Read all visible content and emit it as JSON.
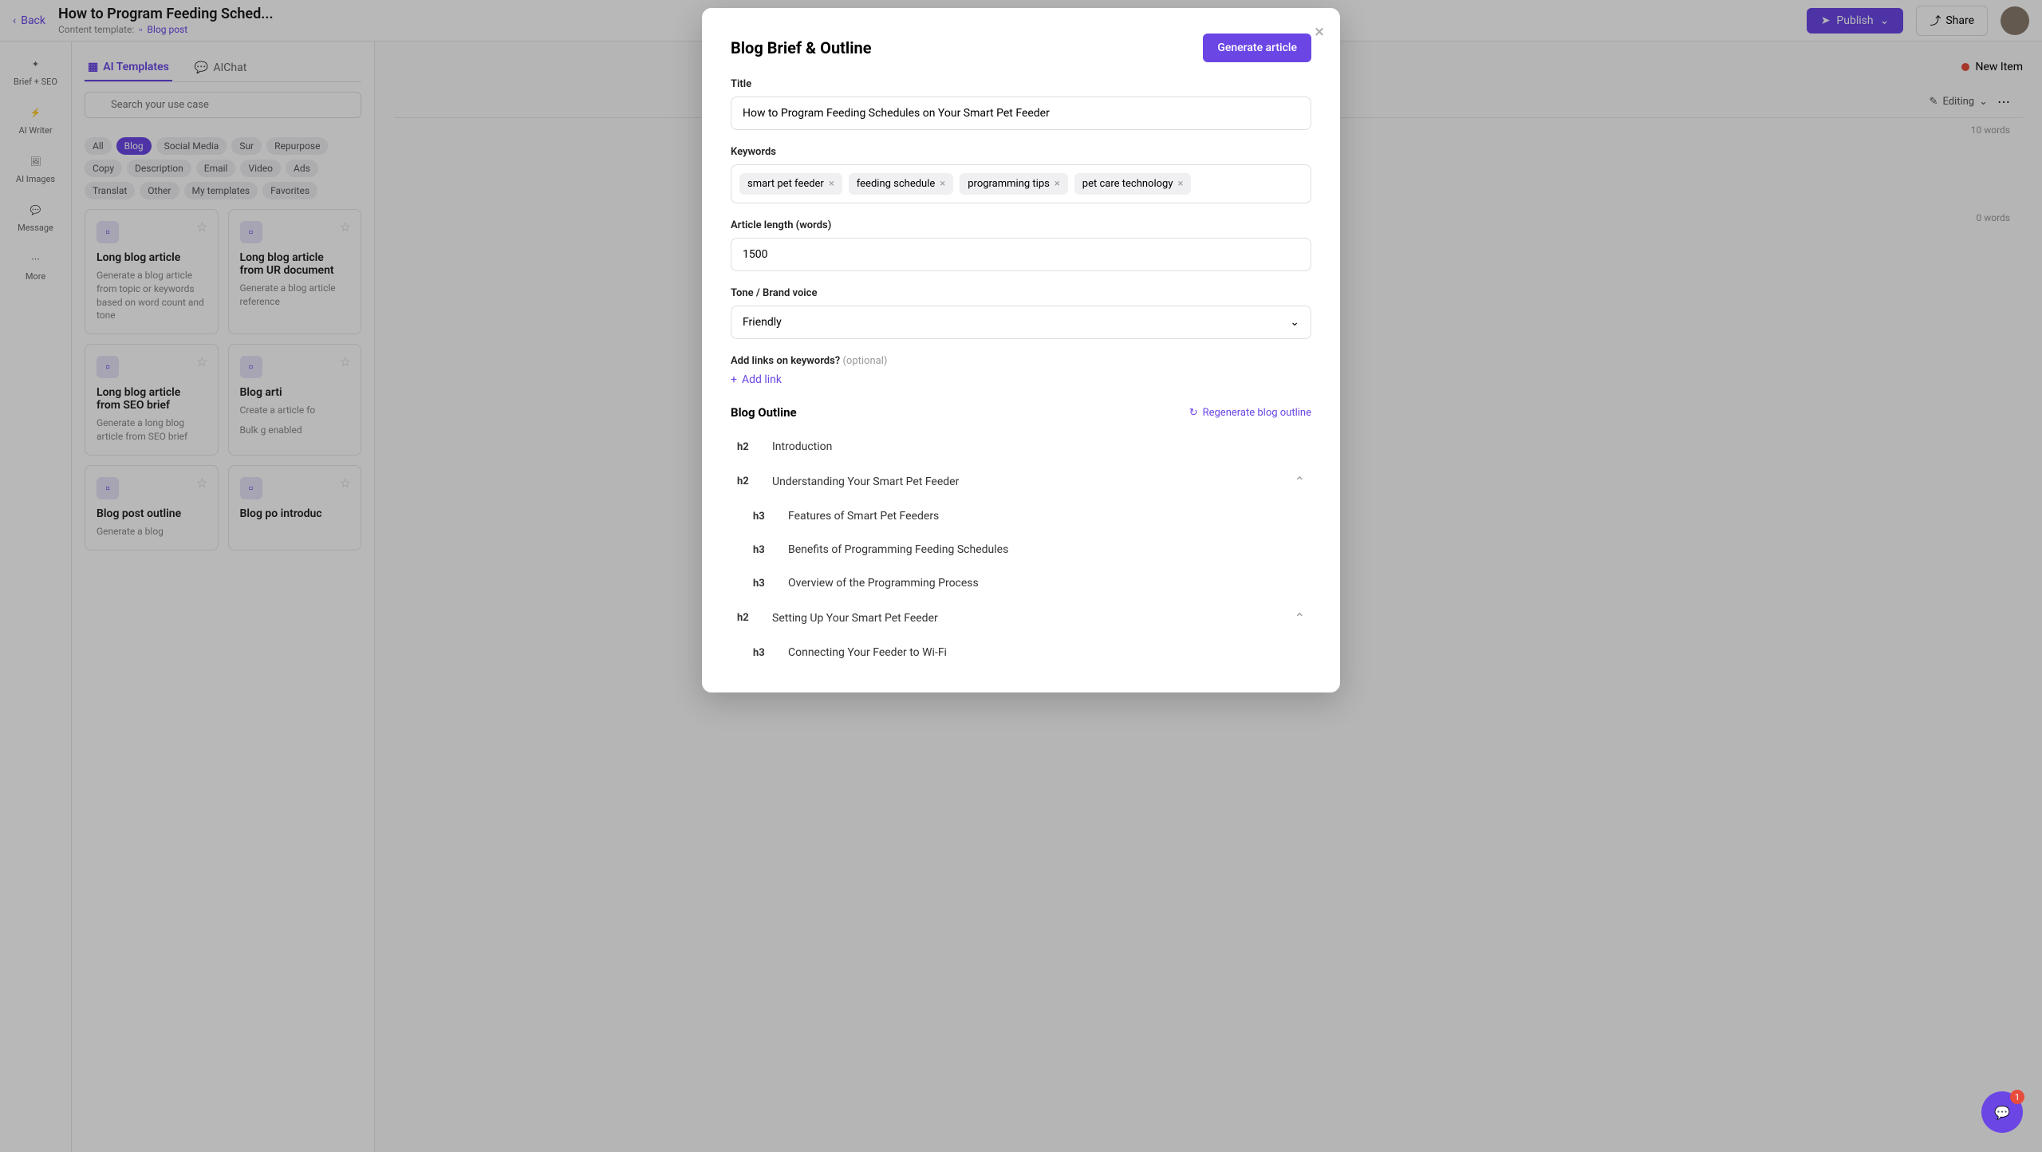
{
  "topbar": {
    "back": "Back",
    "title": "How to Program Feeding Sched...",
    "template_label": "Content template:",
    "template_name": "Blog post",
    "publish": "Publish",
    "share": "Share"
  },
  "sidebar": {
    "brief": "Brief + SEO",
    "writer": "AI Writer",
    "images": "AI Images",
    "message": "Message",
    "more": "More"
  },
  "templates": {
    "tab1": "AI Templates",
    "tab2": "AIChat",
    "search_placeholder": "Search your use case",
    "categories": [
      "All",
      "Blog",
      "Social Media",
      "Sur",
      "Repurpose",
      "Copy",
      "Description",
      "Email",
      "Video",
      "Ads",
      "Translat",
      "Other",
      "My templates",
      "Favorites"
    ],
    "cards": [
      {
        "title": "Long blog article",
        "desc": "Generate a blog article from topic or keywords based on word count and tone"
      },
      {
        "title": "Long blog article from UR document",
        "desc": "Generate a blog article reference"
      },
      {
        "title": "Long blog article from SEO brief",
        "desc": "Generate a long blog article from SEO brief"
      },
      {
        "title": "Blog arti",
        "desc": "Create a article fo",
        "bulk": "Bulk g enabled"
      },
      {
        "title": "Blog post outline",
        "desc": "Generate a blog"
      },
      {
        "title": "Blog po introduc",
        "desc": ""
      }
    ]
  },
  "editor": {
    "new_item": "New Item",
    "editing": "Editing",
    "words1": "10 words",
    "words2": "0 words"
  },
  "modal": {
    "title": "Blog Brief & Outline",
    "generate": "Generate article",
    "title_label": "Title",
    "title_value": "How to Program Feeding Schedules on Your Smart Pet Feeder",
    "keywords_label": "Keywords",
    "keywords": [
      "smart pet feeder",
      "feeding schedule",
      "programming tips",
      "pet care technology"
    ],
    "length_label": "Article length (words)",
    "length_value": "1500",
    "tone_label": "Tone / Brand voice",
    "tone_value": "Friendly",
    "links_label": "Add links on keywords?",
    "links_optional": "(optional)",
    "add_link": "Add link",
    "outline_label": "Blog Outline",
    "regenerate": "Regenerate blog outline",
    "outline": [
      {
        "level": "h2",
        "text": "Introduction",
        "expandable": false
      },
      {
        "level": "h2",
        "text": "Understanding Your Smart Pet Feeder",
        "expandable": true
      },
      {
        "level": "h3",
        "text": "Features of Smart Pet Feeders"
      },
      {
        "level": "h3",
        "text": "Benefits of Programming Feeding Schedules"
      },
      {
        "level": "h3",
        "text": "Overview of the Programming Process"
      },
      {
        "level": "h2",
        "text": "Setting Up Your Smart Pet Feeder",
        "expandable": true
      },
      {
        "level": "h3",
        "text": "Connecting Your Feeder to Wi-Fi"
      }
    ]
  },
  "chat_badge": "1"
}
